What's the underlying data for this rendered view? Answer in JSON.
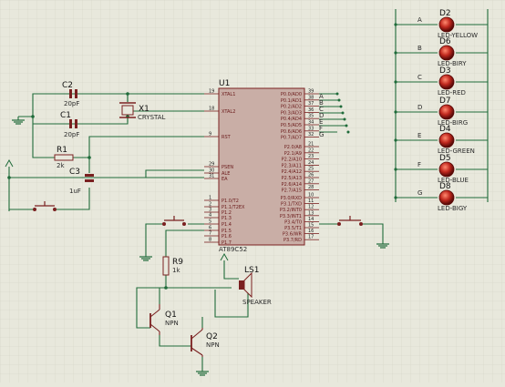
{
  "colors": {
    "background": "#e8e8dc",
    "grid": "#d2d2c4",
    "wire": "#1f6b3a",
    "part": "#7a2020",
    "chip": "#c9aea6",
    "led": "#c0281e"
  },
  "chip": {
    "ref": "U1",
    "name": "AT89C52",
    "left_pins": [
      {
        "num": "19",
        "name": "XTAL1"
      },
      {
        "num": "18",
        "name": "XTAL2"
      },
      {
        "num": "9",
        "name": "RST"
      },
      {
        "num": "29",
        "name": "PSEN"
      },
      {
        "num": "30",
        "name": "ALE"
      },
      {
        "num": "31",
        "name": "EA"
      },
      {
        "num": "1",
        "name": "P1.0/T2"
      },
      {
        "num": "2",
        "name": "P1.1/T2EX"
      },
      {
        "num": "3",
        "name": "P1.2"
      },
      {
        "num": "4",
        "name": "P1.3"
      },
      {
        "num": "5",
        "name": "P1.4"
      },
      {
        "num": "6",
        "name": "P1.5"
      },
      {
        "num": "7",
        "name": "P1.6"
      },
      {
        "num": "8",
        "name": "P1.7"
      }
    ],
    "right_pins": [
      {
        "num": "39",
        "name": "P0.0/AD0"
      },
      {
        "num": "38",
        "name": "P0.1/AD1"
      },
      {
        "num": "37",
        "name": "P0.2/AD2"
      },
      {
        "num": "36",
        "name": "P0.3/AD3"
      },
      {
        "num": "35",
        "name": "P0.4/AD4"
      },
      {
        "num": "34",
        "name": "P0.5/AD5"
      },
      {
        "num": "33",
        "name": "P0.6/AD6"
      },
      {
        "num": "32",
        "name": "P0.7/AD7"
      },
      {
        "num": "21",
        "name": "P2.0/A8"
      },
      {
        "num": "22",
        "name": "P2.1/A9"
      },
      {
        "num": "23",
        "name": "P2.2/A10"
      },
      {
        "num": "24",
        "name": "P2.3/A11"
      },
      {
        "num": "25",
        "name": "P2.4/A12"
      },
      {
        "num": "26",
        "name": "P2.5/A13"
      },
      {
        "num": "27",
        "name": "P2.6/A14"
      },
      {
        "num": "28",
        "name": "P2.7/A15"
      },
      {
        "num": "10",
        "name": "P3.0/RXD"
      },
      {
        "num": "11",
        "name": "P3.1/TXD"
      },
      {
        "num": "12",
        "name": "P3.2/INT0"
      },
      {
        "num": "13",
        "name": "P3.3/INT1"
      },
      {
        "num": "14",
        "name": "P3.4/T0"
      },
      {
        "num": "15",
        "name": "P3.5/T1"
      },
      {
        "num": "16",
        "name": "P3.6/WR"
      },
      {
        "num": "17",
        "name": "P3.7/RD"
      }
    ]
  },
  "net_labels": [
    "A",
    "B",
    "C",
    "D",
    "E",
    "F",
    "G"
  ],
  "leds": [
    {
      "ref": "D2",
      "type": "LED-YELLOW",
      "net": "A"
    },
    {
      "ref": "D6",
      "type": "LED-BIRY",
      "net": "B"
    },
    {
      "ref": "D3",
      "type": "LED-RED",
      "net": "C"
    },
    {
      "ref": "D7",
      "type": "LED-BIRG",
      "net": "D"
    },
    {
      "ref": "D4",
      "type": "LED-GREEN",
      "net": "E"
    },
    {
      "ref": "D5",
      "type": "LED-BLUE",
      "net": "F"
    },
    {
      "ref": "D8",
      "type": "LED-BIGY",
      "net": "G"
    }
  ],
  "parts": {
    "c2": {
      "ref": "C2",
      "value": "20pF"
    },
    "c1": {
      "ref": "C1",
      "value": "20pF"
    },
    "x1": {
      "ref": "X1",
      "value": "CRYSTAL"
    },
    "r1": {
      "ref": "R1",
      "value": "2k"
    },
    "c3": {
      "ref": "C3",
      "value": "1uF"
    },
    "r9": {
      "ref": "R9",
      "value": "1k"
    },
    "ls1": {
      "ref": "LS1",
      "value": "SPEAKER"
    },
    "q1": {
      "ref": "Q1",
      "value": "NPN"
    },
    "q2": {
      "ref": "Q2",
      "value": "NPN"
    }
  }
}
